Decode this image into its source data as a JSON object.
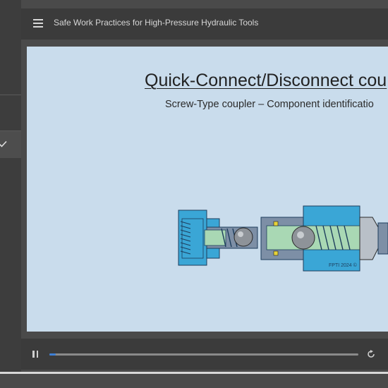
{
  "header": {
    "course_title": "Safe Work Practices for High-Pressure Hydraulic Tools",
    "menu_icon": "hamburger-menu-icon"
  },
  "sidebar": {
    "completed_icon": "check-icon"
  },
  "slide": {
    "title": "Quick-Connect/Disconnect cou",
    "subtitle": "Screw-Type coupler – Component identificatio",
    "diagram_label": "FPTI 2024 ©"
  },
  "playback": {
    "state": "playing",
    "pause_icon": "pause-icon",
    "replay_icon": "replay-icon",
    "progress_fraction": 0.02
  },
  "colors": {
    "slide_background": "#c9dcec",
    "coupler_blue": "#3aa6d6",
    "coupler_gray": "#7d8fa6",
    "seal_green": "#a9d8b4",
    "progress_accent": "#3d7fd6"
  }
}
